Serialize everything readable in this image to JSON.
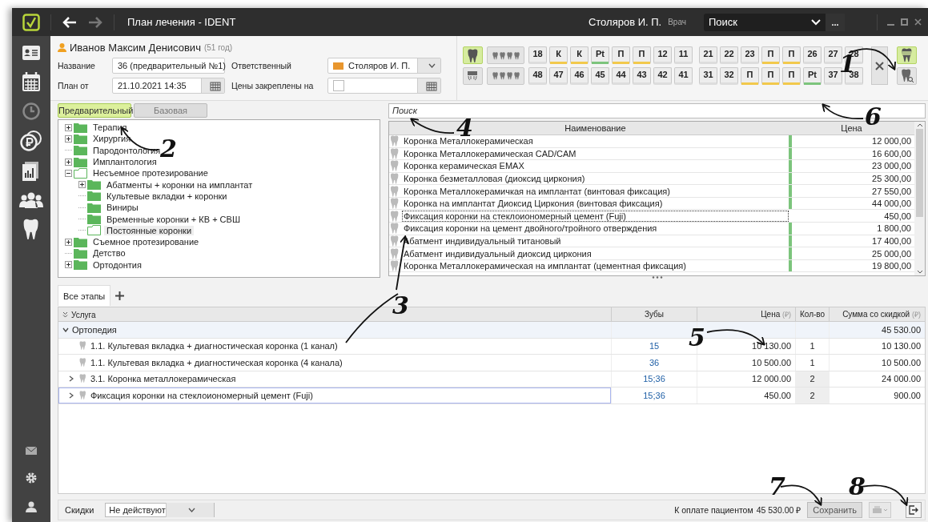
{
  "window": {
    "title": "План лечения  -  IDENT",
    "user": "Столяров И. П.",
    "role": "Врач",
    "search_placeholder": "Поиск",
    "more_button": "..."
  },
  "patient": {
    "name": "Иванов Максим Денисович",
    "age": "(51 год)"
  },
  "plan": {
    "name_label": "Название",
    "name_value": "36 (предварительный №1)",
    "responsible_label": "Ответственный",
    "responsible": {
      "value": "Столяров И. П.",
      "color": "#e8962e"
    },
    "date_label": "План от",
    "date_value": "21.10.2021 14:35",
    "prices_fixed_label": "Цены закреплены на",
    "prices_fixed_checked": false
  },
  "teeth_panel": {
    "view_buttons": [
      {
        "selected": true
      },
      {
        "selected": false
      }
    ],
    "upper": [
      [
        {
          "label": "18"
        },
        {
          "label": "К",
          "color": "#f2c94c"
        },
        {
          "label": "К",
          "color": "#f2c94c"
        },
        {
          "label": "Pt",
          "color": "#7cc47c"
        },
        {
          "label": "П",
          "color": "#f2c94c"
        },
        {
          "label": "П",
          "color": "#f2c94c"
        },
        {
          "label": "12"
        },
        {
          "label": "11"
        }
      ],
      [
        {
          "label": "21"
        },
        {
          "label": "22"
        },
        {
          "label": "23"
        },
        {
          "label": "П",
          "color": "#f2c94c"
        },
        {
          "label": "П",
          "color": "#f2c94c"
        },
        {
          "label": "26"
        },
        {
          "label": "27"
        },
        {
          "label": "28"
        }
      ]
    ],
    "lower": [
      [
        {
          "label": "48"
        },
        {
          "label": "47"
        },
        {
          "label": "46"
        },
        {
          "label": "45"
        },
        {
          "label": "44"
        },
        {
          "label": "43"
        },
        {
          "label": "42"
        },
        {
          "label": "41"
        }
      ],
      [
        {
          "label": "31"
        },
        {
          "label": "32"
        },
        {
          "label": "П",
          "color": "#f2c94c"
        },
        {
          "label": "П",
          "color": "#f2c94c"
        },
        {
          "label": "П",
          "color": "#f2c94c"
        },
        {
          "label": "Pt",
          "color": "#7cc47c"
        },
        {
          "label": "37"
        },
        {
          "label": "38"
        }
      ]
    ],
    "side_buttons": [
      {
        "selected": true
      },
      {
        "selected": false
      }
    ]
  },
  "source_tabs": [
    {
      "label": "Предварительный",
      "selected": true
    },
    {
      "label": "Базовая",
      "selected": false
    }
  ],
  "tree": [
    {
      "label": "Терапия",
      "expandable": true,
      "expanded": false,
      "selected": false
    },
    {
      "label": "Хирургия",
      "expandable": true,
      "expanded": false,
      "selected": false
    },
    {
      "label": "Пародонтология",
      "expandable": false,
      "selected": false
    },
    {
      "label": "Имплантология",
      "expandable": true,
      "expanded": false,
      "selected": false
    },
    {
      "label": "Несъемное протезирование",
      "expandable": true,
      "expanded": true,
      "selected": false,
      "children": [
        {
          "label": "Абатменты + коронки на имплантат",
          "expandable": true,
          "expanded": false,
          "selected": false
        },
        {
          "label": "Культевые вкладки + коронки",
          "expandable": false,
          "selected": false
        },
        {
          "label": "Виниры",
          "expandable": false,
          "selected": false
        },
        {
          "label": "Временные коронки + КВ + СВШ",
          "expandable": false,
          "selected": false
        },
        {
          "label": "Постоянные коронки",
          "expandable": false,
          "selected": true
        }
      ]
    },
    {
      "label": "Съемное протезирование",
      "expandable": true,
      "expanded": false,
      "selected": false
    },
    {
      "label": "Детство",
      "expandable": false,
      "selected": false
    },
    {
      "label": "Ортодонтия",
      "expandable": true,
      "expanded": false,
      "selected": false
    }
  ],
  "price_list": {
    "search_placeholder": "Поиск",
    "columns": [
      "Наименование",
      "Цена"
    ],
    "rows": [
      {
        "name": "Коронка Металлокерамическая",
        "price": "12 000,00",
        "marked": true,
        "focused": false
      },
      {
        "name": "Коронка Металлокерамическая CAD/CAM",
        "price": "16 600,00",
        "marked": true,
        "focused": false
      },
      {
        "name": "Коронка керамическая EMAX",
        "price": "23 000,00",
        "marked": true,
        "focused": false
      },
      {
        "name": "Коронка безметалловая (диоксид циркония)",
        "price": "25 300,00",
        "marked": true,
        "focused": false
      },
      {
        "name": "Коронка Металлокерамичкая на имплантат (винтовая фиксация)",
        "price": "27 550,00",
        "marked": true,
        "focused": false
      },
      {
        "name": "Коронка на имплантат Диоксид Циркония (винтовая фиксация)",
        "price": "44 000,00",
        "marked": true,
        "focused": false
      },
      {
        "name": "Фиксация коронки на стеклоиономерный цемент (Fuji)",
        "price": "450,00",
        "marked": false,
        "focused": true
      },
      {
        "name": "Фиксация коронки на цемент двойного/тройного отверждения",
        "price": "1 800,00",
        "marked": true,
        "focused": false
      },
      {
        "name": "Абатмент индивидуальный титановый",
        "price": "17 400,00",
        "marked": true,
        "focused": false
      },
      {
        "name": "Абатмент индивидуальный диоксид циркония",
        "price": "25 000,00",
        "marked": true,
        "focused": false
      },
      {
        "name": "Коронка Металлокерамическая на имплантат (цементная фиксация)",
        "price": "19 800,00",
        "marked": true,
        "focused": false
      }
    ]
  },
  "stage_tabs": [
    {
      "label": "Все этапы",
      "selected": true
    }
  ],
  "plan_table": {
    "columns": [
      "Услуга",
      "Зубы",
      "Цена",
      "Кол-во",
      "Сумма со скидкой"
    ],
    "currency_mark": [
      "(₽)",
      "(₽)"
    ],
    "rows": [
      {
        "kind": "group",
        "service": "Ортопедия",
        "sum": "45 530.00",
        "expanded": true,
        "selected": false
      },
      {
        "kind": "item",
        "service": "1.1. Культевая вкладка + диагностическая коронка (1 канал)",
        "teeth": "15",
        "price": "10 130.00",
        "qty": "1",
        "sum": "10 130.00",
        "expandable": false,
        "selected": false
      },
      {
        "kind": "item",
        "service": "1.1. Культевая вкладка + диагностическая коронка (4 канала)",
        "teeth": "36",
        "price": "10 500.00",
        "qty": "1",
        "sum": "10 500.00",
        "expandable": false,
        "selected": false
      },
      {
        "kind": "item",
        "service": "3.1. Коронка металлокерамическая",
        "teeth": "15;36",
        "price": "12 000.00",
        "qty": "2",
        "sum": "24 000.00",
        "expandable": true,
        "selected": false
      },
      {
        "kind": "item",
        "service": "Фиксация коронки на стеклоиономерный цемент (Fuji)",
        "teeth": "15;36",
        "price": "450.00",
        "qty": "2",
        "sum": "900.00",
        "expandable": true,
        "selected": true
      }
    ]
  },
  "footer": {
    "discount_label": "Скидки",
    "discount_value": "Не действуют",
    "total_label": "К оплате пациентом",
    "total": "45 530.00 ₽",
    "save_button": "Сохранить"
  },
  "callouts": [
    {
      "label": "1"
    },
    {
      "label": "2"
    },
    {
      "label": "3"
    },
    {
      "label": "4"
    },
    {
      "label": "5"
    },
    {
      "label": "6"
    },
    {
      "label": "7"
    },
    {
      "label": "8"
    }
  ]
}
